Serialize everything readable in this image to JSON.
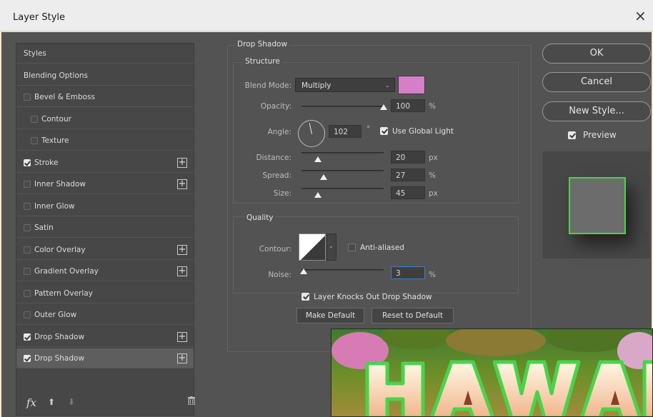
{
  "window": {
    "title": "Layer Style",
    "close_glyph": "×"
  },
  "style_list": {
    "items": [
      {
        "label": "Styles",
        "checkbox": false,
        "checked": false,
        "indent": 0,
        "plus": false,
        "selected": false
      },
      {
        "label": "Blending Options",
        "checkbox": false,
        "checked": false,
        "indent": 0,
        "plus": false,
        "selected": false
      },
      {
        "label": "Bevel & Emboss",
        "checkbox": true,
        "checked": false,
        "indent": 0,
        "plus": false,
        "selected": false
      },
      {
        "label": "Contour",
        "checkbox": true,
        "checked": false,
        "indent": 1,
        "plus": false,
        "selected": false
      },
      {
        "label": "Texture",
        "checkbox": true,
        "checked": false,
        "indent": 1,
        "plus": false,
        "selected": false
      },
      {
        "label": "Stroke",
        "checkbox": true,
        "checked": true,
        "indent": 0,
        "plus": true,
        "selected": false
      },
      {
        "label": "Inner Shadow",
        "checkbox": true,
        "checked": false,
        "indent": 0,
        "plus": true,
        "selected": false
      },
      {
        "label": "Inner Glow",
        "checkbox": true,
        "checked": false,
        "indent": 0,
        "plus": false,
        "selected": false
      },
      {
        "label": "Satin",
        "checkbox": true,
        "checked": false,
        "indent": 0,
        "plus": false,
        "selected": false
      },
      {
        "label": "Color Overlay",
        "checkbox": true,
        "checked": false,
        "indent": 0,
        "plus": true,
        "selected": false
      },
      {
        "label": "Gradient Overlay",
        "checkbox": true,
        "checked": false,
        "indent": 0,
        "plus": true,
        "selected": false
      },
      {
        "label": "Pattern Overlay",
        "checkbox": true,
        "checked": false,
        "indent": 0,
        "plus": false,
        "selected": false
      },
      {
        "label": "Outer Glow",
        "checkbox": true,
        "checked": false,
        "indent": 0,
        "plus": false,
        "selected": false
      },
      {
        "label": "Drop Shadow",
        "checkbox": true,
        "checked": true,
        "indent": 0,
        "plus": true,
        "selected": false
      },
      {
        "label": "Drop Shadow",
        "checkbox": true,
        "checked": true,
        "indent": 0,
        "plus": true,
        "selected": true
      }
    ],
    "footer": {
      "fx_label": "fx",
      "up_glyph": "⬆",
      "down_glyph": "⬇",
      "icons": [
        "fx-icon",
        "move-up-icon",
        "move-down-icon",
        "trash-icon"
      ]
    }
  },
  "drop_shadow": {
    "section_title": "Drop Shadow",
    "structure": {
      "title": "Structure",
      "blend_mode": {
        "label": "Blend Mode:",
        "value": "Multiply",
        "color": "#d47fc8"
      },
      "opacity": {
        "label": "Opacity:",
        "value": "100",
        "unit": "%",
        "fraction": 1.0
      },
      "angle": {
        "label": "Angle:",
        "value": "102",
        "unit": "°",
        "global_light_label": "Use Global Light",
        "global_light_checked": true
      },
      "distance": {
        "label": "Distance:",
        "value": "20",
        "unit": "px",
        "fraction": 0.2
      },
      "spread": {
        "label": "Spread:",
        "value": "27",
        "unit": "%",
        "fraction": 0.27
      },
      "size": {
        "label": "Size:",
        "value": "45",
        "unit": "px",
        "fraction": 0.2
      }
    },
    "quality": {
      "title": "Quality",
      "contour": {
        "label": "Contour:",
        "anti_aliased_label": "Anti-aliased",
        "anti_aliased_checked": false
      },
      "noise": {
        "label": "Noise:",
        "value": "3",
        "unit": "%",
        "fraction": 0.03
      }
    },
    "knockout": {
      "label": "Layer Knocks Out Drop Shadow",
      "checked": true
    },
    "buttons": {
      "make_default": "Make Default",
      "reset_default": "Reset to Default"
    }
  },
  "actions": {
    "ok": "OK",
    "cancel": "Cancel",
    "new_style": "New Style...",
    "preview_label": "Preview",
    "preview_checked": true
  },
  "colors": {
    "panel": "#535353",
    "list": "#474747",
    "stroke_green": "#49d34c",
    "shadow_color": "#d47fc8"
  }
}
